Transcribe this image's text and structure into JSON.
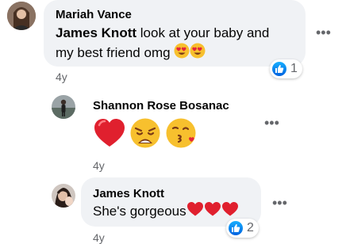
{
  "comments": [
    {
      "author": "Mariah Vance",
      "mention": "James Knott",
      "text_line1": " look at your baby and",
      "text_line2": "my best friend omg",
      "age": "4y",
      "reaction_count": "1",
      "icons": [
        "heart-eyes-emoji",
        "heart-eyes-emoji"
      ]
    },
    {
      "author": "Shannon Rose Bosanac",
      "age": "4y",
      "icons": [
        "red-heart-emoji",
        "weary-face-emoji",
        "kissing-heart-emoji"
      ]
    },
    {
      "author": "James Knott",
      "text": "She's gorgeous",
      "age": "4y",
      "reaction_count": "2",
      "icons": [
        "red-heart-emoji",
        "red-heart-emoji",
        "red-heart-emoji"
      ]
    }
  ],
  "more_icon": "more-options-icon",
  "like_icon": "thumbs-up-icon",
  "colors": {
    "bubble": "#f0f2f5",
    "like_blue": "#1877f2",
    "meta_gray": "#65676b"
  }
}
